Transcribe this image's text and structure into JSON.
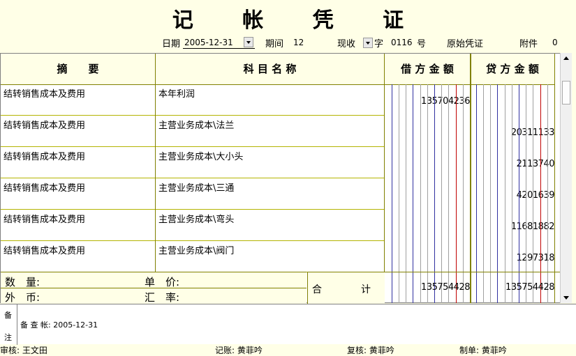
{
  "title": "记 帐 凭 证",
  "header": {
    "date_label": "日期",
    "date_value": "2005-12-31",
    "period_label": "期间",
    "period_value": "12",
    "voucher_type": "现收",
    "word_label": "字",
    "voucher_no": "0116",
    "no_label": "号",
    "original_label": "原始凭证",
    "attach_label": "附件",
    "attach_value": "0"
  },
  "columns": {
    "summary": "摘　　要",
    "account": "科 目 名 称",
    "debit": "借 方 金 额",
    "credit": "贷 方 金 额"
  },
  "rows": [
    {
      "summary": "结转销售成本及费用",
      "account": "本年利润",
      "debit": "135704236",
      "credit": ""
    },
    {
      "summary": "结转销售成本及费用",
      "account": "主营业务成本\\法兰",
      "debit": "",
      "credit": "20311133"
    },
    {
      "summary": "结转销售成本及费用",
      "account": "主营业务成本\\大小头",
      "debit": "",
      "credit": "2113740"
    },
    {
      "summary": "结转销售成本及费用",
      "account": "主营业务成本\\三通",
      "debit": "",
      "credit": "4201639"
    },
    {
      "summary": "结转销售成本及费用",
      "account": "主营业务成本\\弯头",
      "debit": "",
      "credit": "11681882"
    },
    {
      "summary": "结转销售成本及费用",
      "account": "主营业务成本\\阀门",
      "debit": "",
      "credit": "1297318"
    }
  ],
  "footer": {
    "qty_label": "数　量:",
    "price_label": "单　价:",
    "fx_label": "外　币:",
    "rate_label": "汇　率:",
    "total_label": "合　　　　计",
    "debit_total": "135754428",
    "credit_total": "135754428"
  },
  "remark": {
    "label_top": "备",
    "label_bottom": "注",
    "text": "备 查 帐: 2005-12-31"
  },
  "bottom_bar": {
    "text1": "审核: 王文田",
    "text2": "记账: 黄菲吟",
    "text3": "复核: 黄菲吟",
    "text4": "制单: 黄菲吟"
  },
  "colors": {
    "bg": "#ffffe7",
    "grid": "#808000",
    "blue_line": "#3030a0",
    "red_line": "#c00000"
  }
}
